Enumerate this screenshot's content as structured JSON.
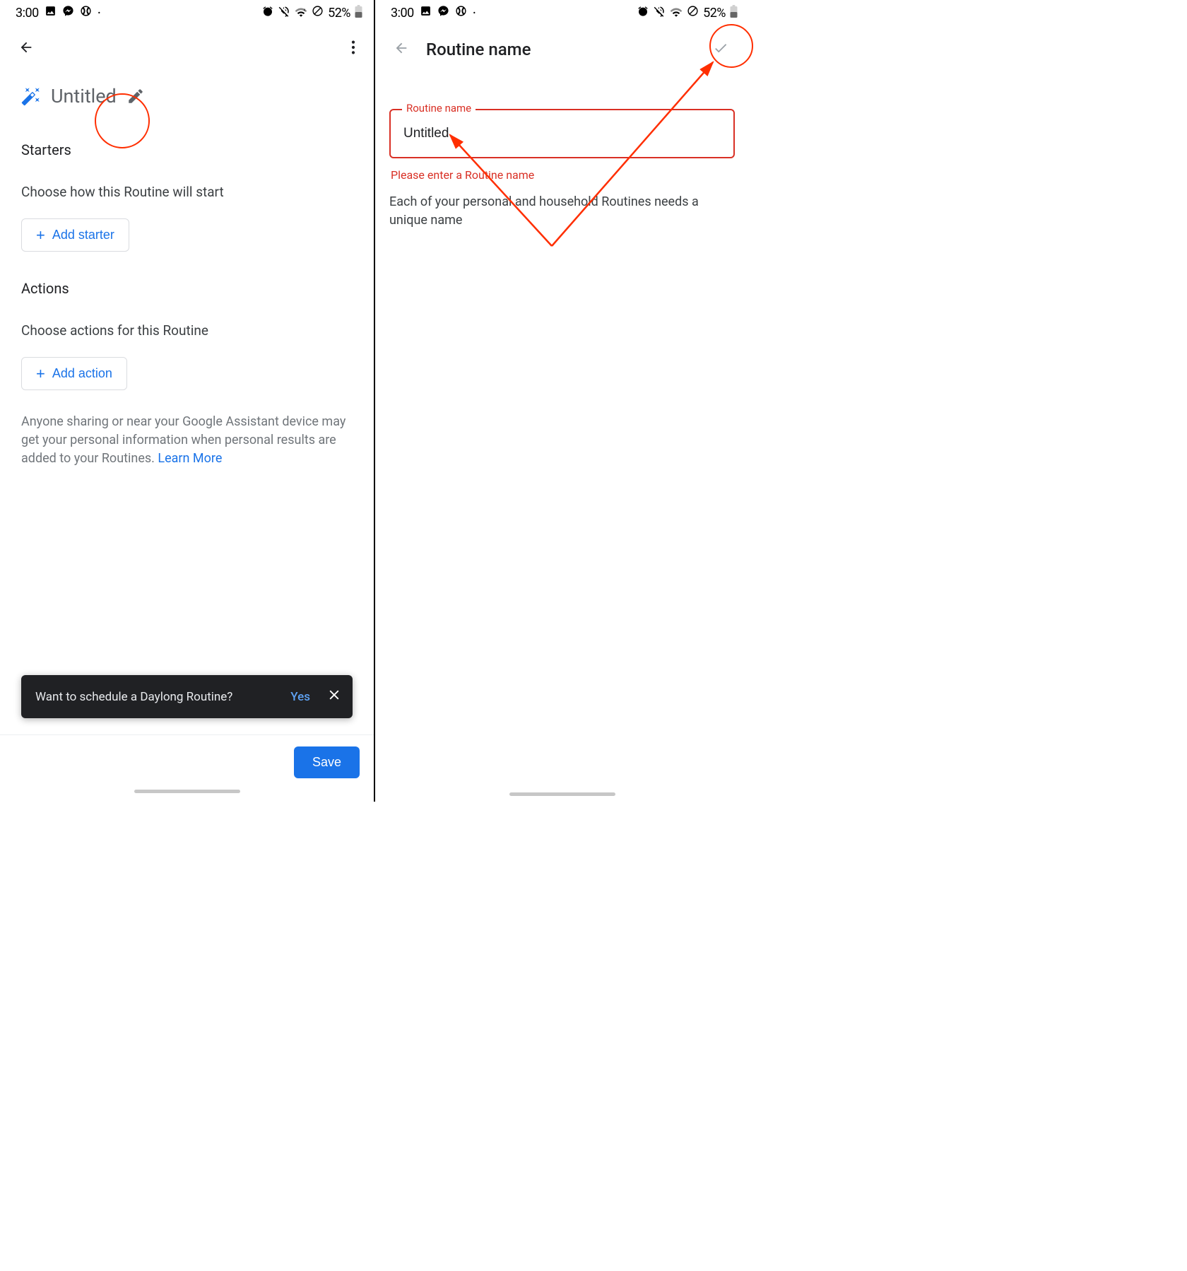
{
  "statusbar": {
    "time": "3:00",
    "battery_pct": "52%"
  },
  "left": {
    "title": "Untitled",
    "starters": {
      "label": "Starters",
      "sub": "Choose how this Routine will start",
      "button": "Add starter"
    },
    "actions": {
      "label": "Actions",
      "sub": "Choose actions for this Routine",
      "button": "Add action"
    },
    "disclosure": "Anyone sharing or near your Google Assistant device may get your personal information when personal results are added to your Routines. ",
    "learn_more": "Learn More",
    "snackbar": {
      "text": "Want to schedule a Daylong Routine?",
      "yes": "Yes"
    },
    "save": "Save"
  },
  "right": {
    "screen_title": "Routine name",
    "field_label": "Routine name",
    "field_value": "Untitled",
    "field_error": "Please enter a Routine name",
    "field_hint": "Each of your personal and household Routines needs a unique name"
  }
}
